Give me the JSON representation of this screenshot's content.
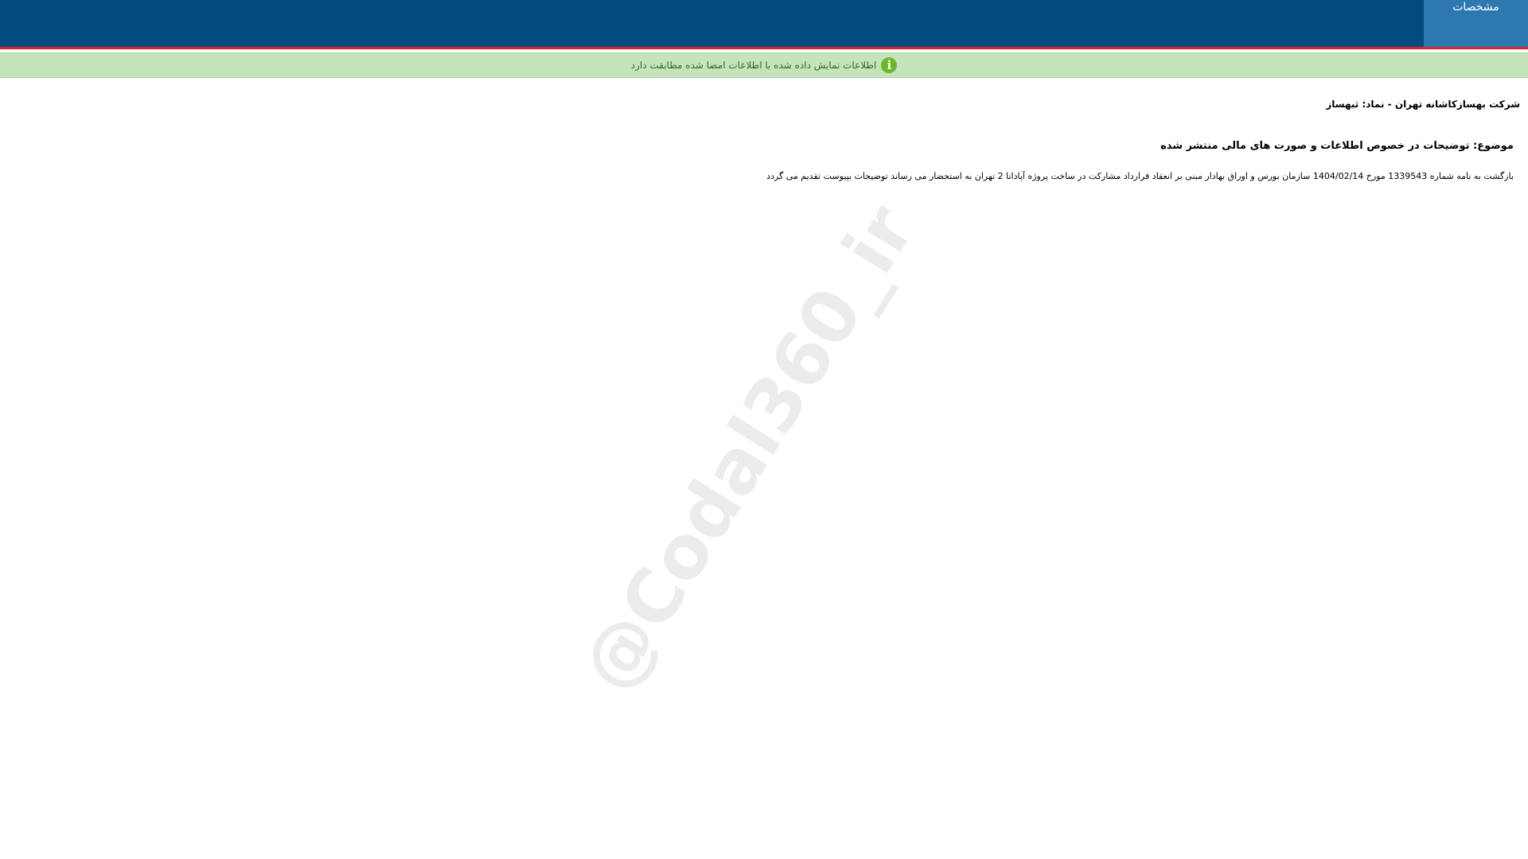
{
  "header": {
    "active_tab_label": "مشخصات",
    "colors": {
      "bar": "#024b80",
      "accent_line": "#e0252b",
      "active_tab": "#2e78b0"
    }
  },
  "notice": {
    "icon": "info-icon",
    "text": "اطلاعات نمایش داده شده با اطلاعات امضا شده مطابقت دارد",
    "background": "#c6e4bb"
  },
  "document": {
    "company_line": "شرکت بهسازکاشانه تهران - نماد: ثبهساز",
    "subject": "موضوع: توضیحات در خصوص اطلاعات و صورت های مالی منتشر شده",
    "body": "بازگشت به نامه شماره 1339543 مورخ 1404/02/14 سازمان بورس و اوراق بهادار مبنی بر انعقاد قرارداد مشارکت در ساخت پروژه آپادانا 2 تهران به استحضار می رساند توضیحات بپیوست تقدیم می گردد"
  },
  "watermark": {
    "text": "@Codal360_ir"
  }
}
